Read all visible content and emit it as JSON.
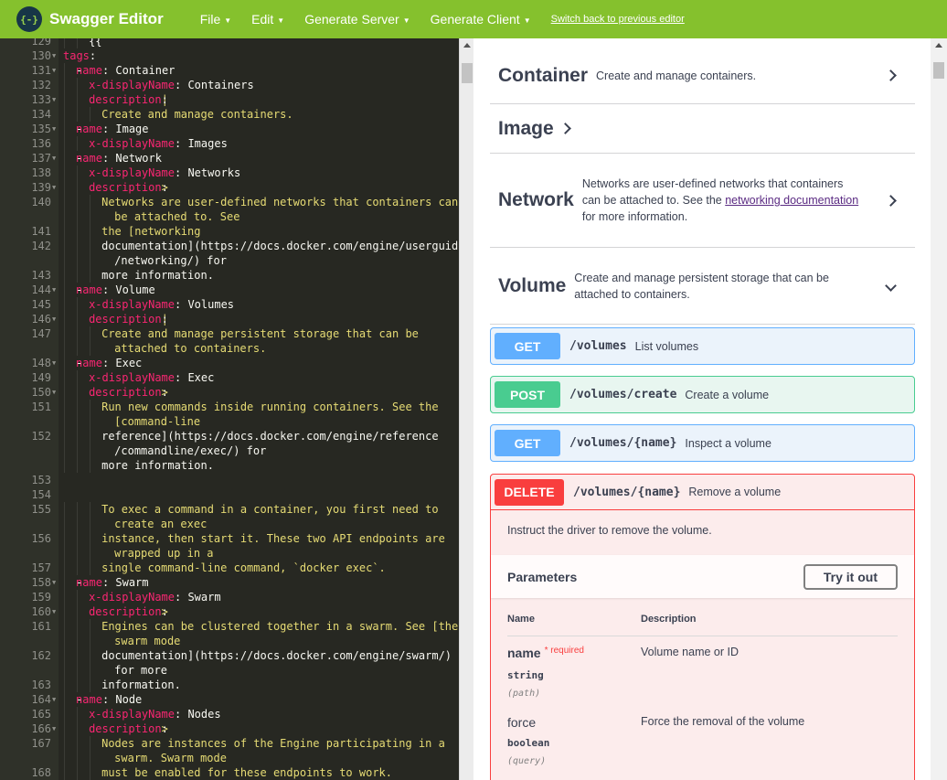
{
  "topbar": {
    "logo_badge": "{-}",
    "logo_text": "Swagger Editor",
    "menu": [
      {
        "label": "File"
      },
      {
        "label": "Edit"
      },
      {
        "label": "Generate Server"
      },
      {
        "label": "Generate Client"
      }
    ],
    "switch_link": "Switch back to previous editor"
  },
  "editor": {
    "lines": [
      {
        "n": "129",
        "fold": false,
        "indent": 4,
        "parts": [
          {
            "t": "{{",
            "c": "txt"
          }
        ]
      },
      {
        "n": "130",
        "fold": true,
        "indent": 0,
        "parts": [
          {
            "t": "tags",
            "c": "k"
          },
          {
            "t": ":",
            "c": "txt"
          }
        ]
      },
      {
        "n": "131",
        "fold": true,
        "indent": 2,
        "parts": [
          {
            "t": "- ",
            "c": "txt"
          },
          {
            "t": "name",
            "c": "k"
          },
          {
            "t": ": Container",
            "c": "txt"
          }
        ]
      },
      {
        "n": "132",
        "fold": false,
        "indent": 4,
        "parts": [
          {
            "t": "x-displayName",
            "c": "k"
          },
          {
            "t": ": Containers",
            "c": "txt"
          }
        ]
      },
      {
        "n": "133",
        "fold": true,
        "indent": 4,
        "parts": [
          {
            "t": "description",
            "c": "k"
          },
          {
            "t": ": ",
            "c": "txt"
          },
          {
            "t": "|",
            "c": "s"
          }
        ]
      },
      {
        "n": "134",
        "fold": false,
        "indent": 6,
        "parts": [
          {
            "t": "Create and manage containers.",
            "c": "s"
          }
        ]
      },
      {
        "n": "135",
        "fold": true,
        "indent": 2,
        "parts": [
          {
            "t": "- ",
            "c": "txt"
          },
          {
            "t": "name",
            "c": "k"
          },
          {
            "t": ": Image",
            "c": "txt"
          }
        ]
      },
      {
        "n": "136",
        "fold": false,
        "indent": 4,
        "parts": [
          {
            "t": "x-displayName",
            "c": "k"
          },
          {
            "t": ": Images",
            "c": "txt"
          }
        ]
      },
      {
        "n": "137",
        "fold": true,
        "indent": 2,
        "parts": [
          {
            "t": "- ",
            "c": "txt"
          },
          {
            "t": "name",
            "c": "k"
          },
          {
            "t": ": Network",
            "c": "txt"
          }
        ]
      },
      {
        "n": "138",
        "fold": false,
        "indent": 4,
        "parts": [
          {
            "t": "x-displayName",
            "c": "k"
          },
          {
            "t": ": Networks",
            "c": "txt"
          }
        ]
      },
      {
        "n": "139",
        "fold": true,
        "indent": 4,
        "parts": [
          {
            "t": "description",
            "c": "k"
          },
          {
            "t": ": ",
            "c": "txt"
          },
          {
            "t": ">",
            "c": "s"
          }
        ]
      },
      {
        "n": "140",
        "fold": false,
        "indent": 6,
        "parts": [
          {
            "t": "Networks are user-defined networks that containers can",
            "c": "s"
          }
        ]
      },
      {
        "n": "",
        "fold": false,
        "indent": 8,
        "parts": [
          {
            "t": "be attached to. See",
            "c": "s"
          }
        ]
      },
      {
        "n": "141",
        "fold": false,
        "indent": 6,
        "parts": [
          {
            "t": "the [networking",
            "c": "s"
          }
        ]
      },
      {
        "n": "142",
        "fold": false,
        "indent": 6,
        "parts": [
          {
            "t": "documentation](https://docs.docker.com/engine/userguide",
            "c": "txt"
          }
        ]
      },
      {
        "n": "",
        "fold": false,
        "indent": 8,
        "parts": [
          {
            "t": "/networking/) for",
            "c": "txt"
          }
        ]
      },
      {
        "n": "143",
        "fold": false,
        "indent": 6,
        "parts": [
          {
            "t": "more information.",
            "c": "txt"
          }
        ]
      },
      {
        "n": "144",
        "fold": true,
        "indent": 2,
        "parts": [
          {
            "t": "- ",
            "c": "txt"
          },
          {
            "t": "name",
            "c": "k"
          },
          {
            "t": ": Volume",
            "c": "txt"
          }
        ]
      },
      {
        "n": "145",
        "fold": false,
        "indent": 4,
        "parts": [
          {
            "t": "x-displayName",
            "c": "k"
          },
          {
            "t": ": Volumes",
            "c": "txt"
          }
        ]
      },
      {
        "n": "146",
        "fold": true,
        "indent": 4,
        "parts": [
          {
            "t": "description",
            "c": "k"
          },
          {
            "t": ": ",
            "c": "txt"
          },
          {
            "t": "|",
            "c": "s"
          }
        ]
      },
      {
        "n": "147",
        "fold": false,
        "indent": 6,
        "parts": [
          {
            "t": "Create and manage persistent storage that can be",
            "c": "s"
          }
        ]
      },
      {
        "n": "",
        "fold": false,
        "indent": 8,
        "parts": [
          {
            "t": "attached to containers.",
            "c": "s"
          }
        ]
      },
      {
        "n": "148",
        "fold": true,
        "indent": 2,
        "parts": [
          {
            "t": "- ",
            "c": "txt"
          },
          {
            "t": "name",
            "c": "k"
          },
          {
            "t": ": Exec",
            "c": "txt"
          }
        ]
      },
      {
        "n": "149",
        "fold": false,
        "indent": 4,
        "parts": [
          {
            "t": "x-displayName",
            "c": "k"
          },
          {
            "t": ": Exec",
            "c": "txt"
          }
        ]
      },
      {
        "n": "150",
        "fold": true,
        "indent": 4,
        "parts": [
          {
            "t": "description",
            "c": "k"
          },
          {
            "t": ": ",
            "c": "txt"
          },
          {
            "t": ">",
            "c": "s"
          }
        ]
      },
      {
        "n": "151",
        "fold": false,
        "indent": 6,
        "parts": [
          {
            "t": "Run new commands inside running containers. See the",
            "c": "s"
          }
        ]
      },
      {
        "n": "",
        "fold": false,
        "indent": 8,
        "parts": [
          {
            "t": "[command-line",
            "c": "s"
          }
        ]
      },
      {
        "n": "152",
        "fold": false,
        "indent": 6,
        "parts": [
          {
            "t": "reference](https://docs.docker.com/engine/reference",
            "c": "txt"
          }
        ]
      },
      {
        "n": "",
        "fold": false,
        "indent": 8,
        "parts": [
          {
            "t": "/commandline/exec/) for",
            "c": "txt"
          }
        ]
      },
      {
        "n": "",
        "fold": false,
        "indent": 6,
        "parts": [
          {
            "t": "more information.",
            "c": "txt"
          }
        ]
      },
      {
        "n": "153",
        "fold": false,
        "indent": 0,
        "parts": []
      },
      {
        "n": "154",
        "fold": false,
        "indent": 0,
        "parts": []
      },
      {
        "n": "155",
        "fold": false,
        "indent": 6,
        "parts": [
          {
            "t": "To exec a command in a container, you first need to",
            "c": "s"
          }
        ]
      },
      {
        "n": "",
        "fold": false,
        "indent": 8,
        "parts": [
          {
            "t": "create an exec",
            "c": "s"
          }
        ]
      },
      {
        "n": "156",
        "fold": false,
        "indent": 6,
        "parts": [
          {
            "t": "instance, then start it. These two API endpoints are",
            "c": "s"
          }
        ]
      },
      {
        "n": "",
        "fold": false,
        "indent": 8,
        "parts": [
          {
            "t": "wrapped up in a",
            "c": "s"
          }
        ]
      },
      {
        "n": "157",
        "fold": false,
        "indent": 6,
        "parts": [
          {
            "t": "single command-line command, `docker exec`.",
            "c": "s"
          }
        ]
      },
      {
        "n": "158",
        "fold": true,
        "indent": 2,
        "parts": [
          {
            "t": "- ",
            "c": "txt"
          },
          {
            "t": "name",
            "c": "k"
          },
          {
            "t": ": Swarm",
            "c": "txt"
          }
        ]
      },
      {
        "n": "159",
        "fold": false,
        "indent": 4,
        "parts": [
          {
            "t": "x-displayName",
            "c": "k"
          },
          {
            "t": ": Swarm",
            "c": "txt"
          }
        ]
      },
      {
        "n": "160",
        "fold": true,
        "indent": 4,
        "parts": [
          {
            "t": "description",
            "c": "k"
          },
          {
            "t": ": ",
            "c": "txt"
          },
          {
            "t": ">",
            "c": "s"
          }
        ]
      },
      {
        "n": "161",
        "fold": false,
        "indent": 6,
        "parts": [
          {
            "t": "Engines can be clustered together in a swarm. See [the",
            "c": "s"
          }
        ]
      },
      {
        "n": "",
        "fold": false,
        "indent": 8,
        "parts": [
          {
            "t": "swarm mode",
            "c": "s"
          }
        ]
      },
      {
        "n": "162",
        "fold": false,
        "indent": 6,
        "parts": [
          {
            "t": "documentation](https://docs.docker.com/engine/swarm/)",
            "c": "txt"
          }
        ]
      },
      {
        "n": "",
        "fold": false,
        "indent": 8,
        "parts": [
          {
            "t": "for more",
            "c": "txt"
          }
        ]
      },
      {
        "n": "163",
        "fold": false,
        "indent": 6,
        "parts": [
          {
            "t": "information.",
            "c": "txt"
          }
        ]
      },
      {
        "n": "164",
        "fold": true,
        "indent": 2,
        "parts": [
          {
            "t": "- ",
            "c": "txt"
          },
          {
            "t": "name",
            "c": "k"
          },
          {
            "t": ": Node",
            "c": "txt"
          }
        ]
      },
      {
        "n": "165",
        "fold": false,
        "indent": 4,
        "parts": [
          {
            "t": "x-displayName",
            "c": "k"
          },
          {
            "t": ": Nodes",
            "c": "txt"
          }
        ]
      },
      {
        "n": "166",
        "fold": true,
        "indent": 4,
        "parts": [
          {
            "t": "description",
            "c": "k"
          },
          {
            "t": ": ",
            "c": "txt"
          },
          {
            "t": ">",
            "c": "s"
          }
        ]
      },
      {
        "n": "167",
        "fold": false,
        "indent": 6,
        "parts": [
          {
            "t": "Nodes are instances of the Engine participating in a",
            "c": "s"
          }
        ]
      },
      {
        "n": "",
        "fold": false,
        "indent": 8,
        "parts": [
          {
            "t": "swarm. Swarm mode",
            "c": "s"
          }
        ]
      },
      {
        "n": "168",
        "fold": false,
        "indent": 6,
        "parts": [
          {
            "t": "must be enabled for these endpoints to work.",
            "c": "s"
          }
        ]
      }
    ]
  },
  "preview": {
    "tags": [
      {
        "name": "Container",
        "description": "Create and manage containers."
      },
      {
        "name": "Image",
        "description": ""
      },
      {
        "name": "Network",
        "desc_pre": "Networks are user-defined networks that containers can be attached to. See the ",
        "desc_link": "networking documentation",
        "desc_post": " for more information."
      },
      {
        "name": "Volume",
        "description": "Create and manage persistent storage that can be attached to containers."
      }
    ],
    "operations": [
      {
        "method": "GET",
        "path": "/volumes",
        "summary": "List volumes"
      },
      {
        "method": "POST",
        "path": "/volumes/create",
        "summary": "Create a volume"
      },
      {
        "method": "GET",
        "path": "/volumes/{name}",
        "summary": "Inspect a volume"
      }
    ],
    "delete_op": {
      "method": "DELETE",
      "path": "/volumes/{name}",
      "summary": "Remove a volume",
      "description": "Instruct the driver to remove the volume.",
      "parameters_title": "Parameters",
      "try_label": "Try it out",
      "col_name": "Name",
      "col_desc": "Description",
      "params": [
        {
          "name": "name",
          "required_label": "* required",
          "type": "string",
          "in": "(path)",
          "description": "Volume name or ID"
        },
        {
          "name": "force",
          "type": "boolean",
          "in": "(query)",
          "description": "Force the removal of the volume"
        }
      ]
    }
  }
}
